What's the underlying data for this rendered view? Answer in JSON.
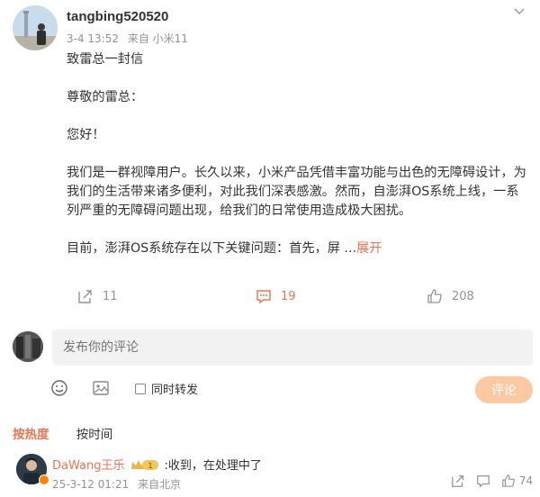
{
  "post": {
    "author": "tangbing520520",
    "time": "3-4 13:52",
    "source": "来自 小米11",
    "paragraphs": [
      "致雷总一封信",
      "尊敬的雷总：",
      "您好！",
      "我们是一群视障用户。长久以来，小米产品凭借丰富功能与出色的无障碍设计，为我们的生活带来诸多便利，对此我们深表感激。然而，自澎湃OS系统上线，一系列严重的无障碍问题出现，给我们的日常使用造成极大困扰。"
    ],
    "truncated_text": "目前，澎湃OS系统存在以下关键问题：首先，屏 ...",
    "expand_label": "展开"
  },
  "actions": {
    "repost_count": "11",
    "comment_count": "19",
    "like_count": "208",
    "accent_color": "#eb7350"
  },
  "composer": {
    "placeholder": "发布你的评论",
    "repost_label": "同时转发",
    "submit_label": "评论"
  },
  "sort": {
    "hot_label": "按热度",
    "time_label": "按时间"
  },
  "comment": {
    "user": "DaWang王乐",
    "medal_level": "1",
    "text": ":收到，在处理中了",
    "time": "25-3-12 01:21",
    "location": "来自北京",
    "like_count": "74"
  }
}
